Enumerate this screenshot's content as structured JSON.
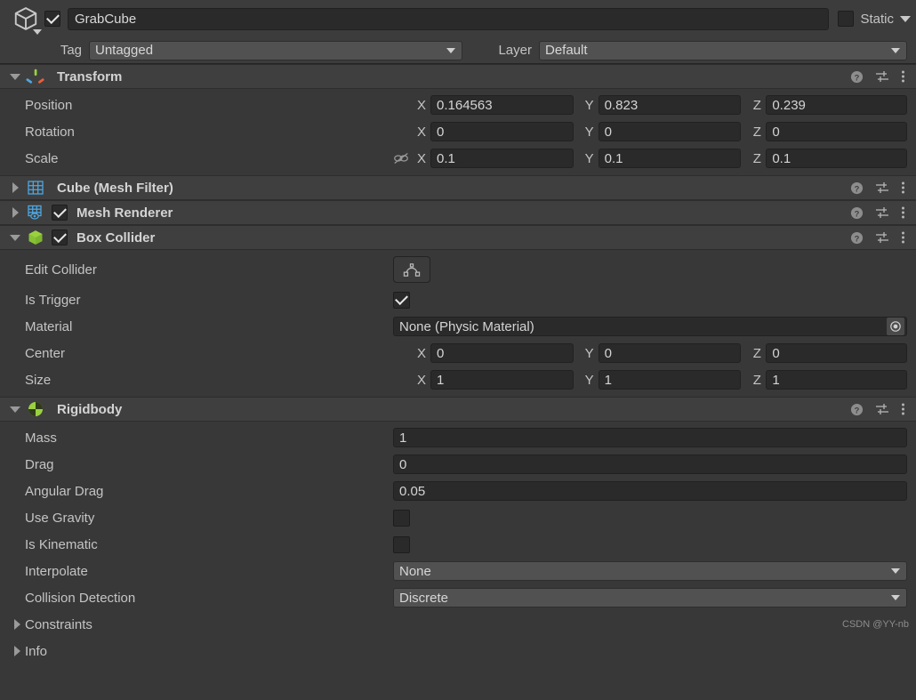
{
  "header": {
    "object_icon": "cube-gameobject-icon",
    "enabled": true,
    "name": "GrabCube",
    "static_checked": false,
    "static_label": "Static",
    "tag_label": "Tag",
    "tag_value": "Untagged",
    "layer_label": "Layer",
    "layer_value": "Default"
  },
  "components": [
    {
      "id": "transform",
      "title": "Transform",
      "icon": "transform-axis-icon",
      "expanded": true,
      "has_enable_checkbox": false,
      "rows": [
        {
          "label": "Position",
          "type": "vector3",
          "x": "0.164563",
          "y": "0.823",
          "z": "0.239",
          "link": false
        },
        {
          "label": "Rotation",
          "type": "vector3",
          "x": "0",
          "y": "0",
          "z": "0",
          "link": false
        },
        {
          "label": "Scale",
          "type": "vector3",
          "x": "0.1",
          "y": "0.1",
          "z": "0.1",
          "link": true,
          "link_icon": "scale-unlinked-icon"
        }
      ]
    },
    {
      "id": "mesh-filter",
      "title": "Cube (Mesh Filter)",
      "icon": "mesh-filter-icon",
      "expanded": false,
      "has_enable_checkbox": false,
      "rows": []
    },
    {
      "id": "mesh-renderer",
      "title": "Mesh Renderer",
      "icon": "mesh-renderer-icon",
      "expanded": false,
      "has_enable_checkbox": true,
      "enabled": true,
      "rows": []
    },
    {
      "id": "box-collider",
      "title": "Box Collider",
      "icon": "box-collider-icon",
      "expanded": true,
      "has_enable_checkbox": true,
      "enabled": true,
      "rows": [
        {
          "label": "Edit Collider",
          "type": "button",
          "button_icon": "edit-collider-icon"
        },
        {
          "label": "Is Trigger",
          "type": "checkbox",
          "checked": true
        },
        {
          "label": "Material",
          "type": "object",
          "value": "None (Physic Material)"
        },
        {
          "label": "Center",
          "type": "vector3",
          "x": "0",
          "y": "0",
          "z": "0",
          "link": false
        },
        {
          "label": "Size",
          "type": "vector3",
          "x": "1",
          "y": "1",
          "z": "1",
          "link": false
        }
      ]
    },
    {
      "id": "rigidbody",
      "title": "Rigidbody",
      "icon": "rigidbody-icon",
      "expanded": true,
      "has_enable_checkbox": false,
      "rows": [
        {
          "label": "Mass",
          "type": "text",
          "value": "1"
        },
        {
          "label": "Drag",
          "type": "text",
          "value": "0"
        },
        {
          "label": "Angular Drag",
          "type": "text",
          "value": "0.05"
        },
        {
          "label": "Use Gravity",
          "type": "checkbox",
          "checked": false
        },
        {
          "label": "Is Kinematic",
          "type": "checkbox",
          "checked": false
        },
        {
          "label": "Interpolate",
          "type": "dropdown",
          "value": "None"
        },
        {
          "label": "Collision Detection",
          "type": "dropdown",
          "value": "Discrete"
        },
        {
          "label": "Constraints",
          "type": "foldout",
          "expanded": false
        },
        {
          "label": "Info",
          "type": "foldout",
          "expanded": false
        }
      ]
    }
  ],
  "header_icons": {
    "help": "help-icon",
    "preset": "preset-icon",
    "menu": "more-menu-icon"
  },
  "watermark": "CSDN @YY-nb",
  "colors": {
    "background": "#383838",
    "header_bg": "#3c3c3c",
    "component_header_bg": "#3f3f3f",
    "field_bg": "#2a2a2a",
    "dropdown_bg": "#515151",
    "text": "#c4c4c4",
    "accent_green": "#9ad140",
    "accent_blue": "#4ea6e0"
  }
}
